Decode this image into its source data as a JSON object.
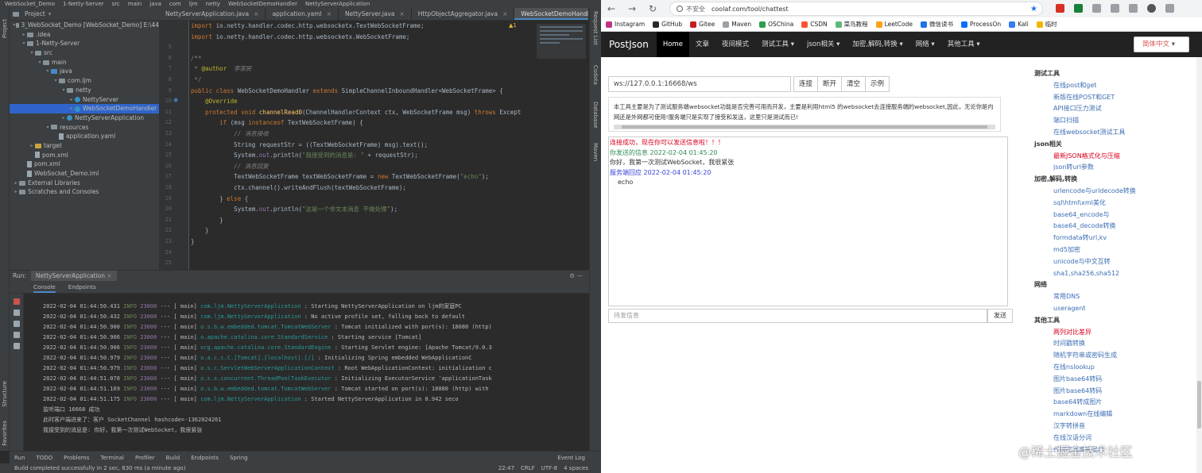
{
  "ide": {
    "top_crumbs": [
      "WebSocket_Demo",
      "1-Netty-Server",
      "src",
      "main",
      "java",
      "com",
      "ljm",
      "netty",
      "WebSocketDemoHandler",
      "NettyServerApplication"
    ],
    "tabs": [
      {
        "label": "NettyServerApplication.java"
      },
      {
        "label": "application.yaml"
      },
      {
        "label": "NettyServer.java"
      },
      {
        "label": "HttpObjectAggregator.java"
      },
      {
        "label": "WebSocketDemoHandler.java",
        "active": true
      }
    ],
    "project_header": "Project",
    "tree": [
      {
        "label": "3_WebSocket_Demo [WebSocket_Demo]  E:\\44",
        "indent": 0,
        "arrow": "▾",
        "icon": "folder"
      },
      {
        "label": ".idea",
        "indent": 1,
        "arrow": "▸",
        "icon": "folder"
      },
      {
        "label": "1-Netty-Server",
        "indent": 1,
        "arrow": "▾",
        "icon": "folder"
      },
      {
        "label": "src",
        "indent": 2,
        "arrow": "▾",
        "icon": "folder"
      },
      {
        "label": "main",
        "indent": 3,
        "arrow": "▾",
        "icon": "folder"
      },
      {
        "label": "java",
        "indent": 4,
        "arrow": "▾",
        "icon": "folder-blue"
      },
      {
        "label": "com.ljm",
        "indent": 5,
        "arrow": "▾",
        "icon": "folder"
      },
      {
        "label": "netty",
        "indent": 6,
        "arrow": "▾",
        "icon": "folder"
      },
      {
        "label": "NettyServer",
        "indent": 7,
        "arrow": "▸",
        "icon": "class"
      },
      {
        "label": "WebSocketDemoHandler",
        "indent": 7,
        "arrow": "▸",
        "icon": "class",
        "selected": true
      },
      {
        "label": "NettyServerApplication",
        "indent": 6,
        "arrow": "▸",
        "icon": "class"
      },
      {
        "label": "resources",
        "indent": 4,
        "arrow": "▾",
        "icon": "folder"
      },
      {
        "label": "application.yaml",
        "indent": 5,
        "arrow": "",
        "icon": "file"
      },
      {
        "label": "target",
        "indent": 2,
        "arrow": "▸",
        "icon": "folder-org"
      },
      {
        "label": "pom.xml",
        "indent": 2,
        "arrow": "",
        "icon": "file"
      },
      {
        "label": "pom.xml",
        "indent": 1,
        "arrow": "",
        "icon": "file"
      },
      {
        "label": "WebSocket_Demo.iml",
        "indent": 1,
        "arrow": "",
        "icon": "file"
      },
      {
        "label": "External Libraries",
        "indent": 0,
        "arrow": "▸",
        "icon": "folder"
      },
      {
        "label": "Scratches and Consoles",
        "indent": 0,
        "arrow": "▸",
        "icon": "folder"
      }
    ],
    "code_lines": [
      {
        "n": "",
        "html": "<span class='kw'>import</span> io.netty.handler.codec.http.websocketx.<span>TextWebSocketFrame</span>;"
      },
      {
        "n": "",
        "html": "<span class='kw'>import</span> io.netty.handler.codec.http.websocketx.WebSocketFrame;"
      },
      {
        "n": "5",
        "html": ""
      },
      {
        "n": "6",
        "html": "<span class='cm'>/**</span>"
      },
      {
        "n": "7",
        "html": "<span class='cm'> * </span><span class='an'>@author</span><span class='cm'>  李家民</span>"
      },
      {
        "n": "8",
        "html": "<span class='cm'> */</span>"
      },
      {
        "n": "9",
        "html": "<span class='kw'>public class</span> WebSocketDemoHandler <span class='kw'>extends</span> SimpleChannelInboundHandler&lt;WebSocketFrame&gt; {"
      },
      {
        "n": "10",
        "html": "    <span class='an'>@Override</span>"
      },
      {
        "n": "11",
        "html": "    <span class='kw'>protected void</span> <span class='fn'>channelRead0</span>(ChannelHandlerContext ctx, WebSocketFrame msg) <span class='kw'>throws</span> Except"
      },
      {
        "n": "12",
        "html": "        <span class='kw'>if</span> (msg <span class='kw'>instanceof</span> TextWebSocketFrame) {"
      },
      {
        "n": "13",
        "html": "            <span class='cm'>// 消息接收</span>"
      },
      {
        "n": "14",
        "html": "            String requestStr = ((TextWebSocketFrame) msg).text();"
      },
      {
        "n": "15",
        "html": "            System.<span class='fi'>out</span>.println(<span class='st'>\"我接受到的消息是: \"</span> + requestStr);"
      },
      {
        "n": "16",
        "html": "            <span class='cm'>// 消息回复</span>"
      },
      {
        "n": "17",
        "html": "            TextWebSocketFrame textWebSocketFrame = <span class='kw'>new</span> TextWebSocketFrame(<span class='st'>\"echo\"</span>);"
      },
      {
        "n": "18",
        "html": "            ctx.channel().writeAndFlush(textWebSocketFrame);"
      },
      {
        "n": "19",
        "html": "        } <span class='kw'>else</span> {"
      },
      {
        "n": "20",
        "html": "            System.<span class='fi'>out</span>.println(<span class='st'>\"这是一个非文本消息 不做处理\"</span>);"
      },
      {
        "n": "21",
        "html": "        }"
      },
      {
        "n": "22",
        "html": "    }"
      },
      {
        "n": "23",
        "html": "}"
      },
      {
        "n": "24",
        "html": ""
      },
      {
        "n": "25",
        "html": ""
      },
      {
        "n": "26",
        "html": ""
      }
    ],
    "warn_count": "▲1",
    "run_label": "Run:",
    "run_tab": "NettyServerApplication",
    "run_subtabs": [
      "Console",
      "Endpoints"
    ],
    "console_lines": [
      {
        "ts": "2022-02-04 01:44:50.431",
        "lv": "INFO",
        "pid": "23000",
        "th": "---  [           main]",
        "lg": "com.ljm.NettyServerApplication          ",
        "msg": ": Starting NettyServerApplication on ljm的家庭PC"
      },
      {
        "ts": "2022-02-04 01:44:50.432",
        "lv": "INFO",
        "pid": "23000",
        "th": "---  [           main]",
        "lg": "com.ljm.NettyServerApplication          ",
        "msg": ": No active profile set, falling back to default"
      },
      {
        "ts": "2022-02-04 01:44:50.900",
        "lv": "INFO",
        "pid": "23000",
        "th": "---  [           main]",
        "lg": "o.s.b.w.embedded.tomcat.TomcatWebServer ",
        "msg": ": Tomcat initialized with port(s): 18080 (http)"
      },
      {
        "ts": "2022-02-04 01:44:50.906",
        "lv": "INFO",
        "pid": "23000",
        "th": "---  [           main]",
        "lg": "o.apache.catalina.core.StandardService  ",
        "msg": ": Starting service [Tomcat]"
      },
      {
        "ts": "2022-02-04 01:44:50.906",
        "lv": "INFO",
        "pid": "23000",
        "th": "---  [           main]",
        "lg": "org.apache.catalina.core.StandardEngine ",
        "msg": ": Starting Servlet engine: [Apache Tomcat/9.0.3"
      },
      {
        "ts": "2022-02-04 01:44:50.979",
        "lv": "INFO",
        "pid": "23000",
        "th": "---  [           main]",
        "lg": "o.a.c.c.C.[Tomcat].[localhost].[/]     ",
        "msg": ": Initializing Spring embedded WebApplicationC"
      },
      {
        "ts": "2022-02-04 01:44:50.979",
        "lv": "INFO",
        "pid": "23000",
        "th": "---  [           main]",
        "lg": "o.s.c.ServletWebServerApplicationContext",
        "msg": ": Root WebApplicationContext: initialization c"
      },
      {
        "ts": "2022-02-04 01:44:51.078",
        "lv": "INFO",
        "pid": "23000",
        "th": "---  [           main]",
        "lg": "o.s.s.concurrent.ThreadPoolTaskExecutor ",
        "msg": ": Initializing ExecutorService 'applicationTask"
      },
      {
        "ts": "2022-02-04 01:44:51.169",
        "lv": "INFO",
        "pid": "23000",
        "th": "---  [           main]",
        "lg": "o.s.b.w.embedded.tomcat.TomcatWebServer ",
        "msg": ": Tomcat started on port(s): 18080 (http) with"
      },
      {
        "ts": "2022-02-04 01:44:51.175",
        "lv": "INFO",
        "pid": "23000",
        "th": "---  [           main]",
        "lg": "com.ljm.NettyServerApplication          ",
        "msg": ": Started NettyServerApplication in 0.942 seco"
      }
    ],
    "console_plain": [
      "监听端口 16668 成功",
      "此时客户端进来了：客户 SocketChannel hashcode=-1362024261",
      "我接受到的消息是: 你好，我第一次测试WebSocket，我很紧张"
    ],
    "bottom_tabs": [
      "Run",
      "TODO",
      "Problems",
      "Terminal",
      "Profiler",
      "Build",
      "Endpoints",
      "Spring"
    ],
    "event_log": "Event Log",
    "status_text": "Build completed successfully in 2 sec, 830 ms (a minute ago)",
    "status_right": [
      "22:47",
      "CRLF",
      "UTF-8",
      "4 spaces"
    ],
    "left_labels": [
      "Project",
      "Structure",
      "Favorites"
    ],
    "right_labels": [
      "Request List",
      "Codota",
      "Database",
      "Maven"
    ]
  },
  "browser": {
    "not_secure": "不安全",
    "url": "coolaf.com/tool/chattest",
    "bookmarks": [
      {
        "label": "Instagram",
        "color": "#c13584"
      },
      {
        "label": "GitHub",
        "color": "#24292e"
      },
      {
        "label": "Gitee",
        "color": "#c71d23"
      },
      {
        "label": "Maven",
        "color": "#9aa0a6"
      },
      {
        "label": "OSChina",
        "color": "#2e9e4f"
      },
      {
        "label": "CSDN",
        "color": "#fc5531"
      },
      {
        "label": "菜鸟教程",
        "color": "#5fb878"
      },
      {
        "label": "LeetCode",
        "color": "#ffa116"
      },
      {
        "label": "微信读书",
        "color": "#1a73e8"
      },
      {
        "label": "ProcessOn",
        "color": "#0d6efd"
      },
      {
        "label": "Kali",
        "color": "#367bf0"
      },
      {
        "label": "临时",
        "color": "#f2b600"
      }
    ],
    "nav": {
      "brand": "PostJson",
      "items": [
        {
          "label": "Home",
          "active": true
        },
        {
          "label": "文章"
        },
        {
          "label": "夜间模式"
        },
        {
          "label": "测试工具 ▾"
        },
        {
          "label": "json相关 ▾"
        },
        {
          "label": "加密,解码,转换 ▾"
        },
        {
          "label": "网络 ▾"
        },
        {
          "label": "其他工具 ▾"
        }
      ],
      "lang": "简体中文"
    },
    "ws_url": "ws://127.0.0.1:16668/ws",
    "buttons": [
      "连接",
      "断开",
      "清空",
      "示例"
    ],
    "description": "本工具主要是为了测试服务端websocket功能是否完善可用而开发，主要是利用html5 的websocket去连接服务端的websocket,因此，无论你是内网还是外网都可使用!服务端只是实现了接受和发送，这里只是测试而已!",
    "messages": [
      {
        "text": "连接成功，现在你可以发送信息啦！！！",
        "cls": "m-red"
      },
      {
        "text": "你发送的信息 2022-02-04 01:45:20",
        "cls": "m-green"
      },
      {
        "text": "你好，我第一次测试WebSocket，我很紧张",
        "cls": "m-dark"
      },
      {
        "text": "服务端回应 2022-02-04 01:45:20",
        "cls": "m-blue"
      },
      {
        "text": "echo",
        "cls": "m-ind"
      }
    ],
    "send_placeholder": "待发信息",
    "send_button": "发送",
    "sidebar": [
      {
        "h": "测试工具",
        "items": [
          {
            "t": "在线post和get"
          },
          {
            "t": "新版在线POST和GET"
          },
          {
            "t": "API接口压力测试"
          },
          {
            "t": "端口扫描"
          },
          {
            "t": "在线websocket测试工具"
          }
        ]
      },
      {
        "h": "json相关",
        "items": [
          {
            "t": "最新JSON格式化与压缩",
            "red": true
          },
          {
            "t": "json转url参数"
          }
        ]
      },
      {
        "h": "加密,解码,转换",
        "items": [
          {
            "t": "urlencode与urldecode转换"
          },
          {
            "t": "sql\\html\\xml美化"
          },
          {
            "t": "base64_encode与"
          },
          {
            "t": "base64_decode转换"
          },
          {
            "t": "formdata转url,kv"
          },
          {
            "t": "md5加密"
          },
          {
            "t": "unicode与中文互转"
          },
          {
            "t": "sha1,sha256,sha512"
          }
        ]
      },
      {
        "h": "网络",
        "items": [
          {
            "t": "常用DNS"
          },
          {
            "t": "useragent"
          }
        ]
      },
      {
        "h": "其他工具",
        "items": [
          {
            "t": "两列对比差异",
            "red": true
          },
          {
            "t": "时间戳转换"
          },
          {
            "t": "随机字符串或密码生成"
          },
          {
            "t": "在线nslookup"
          },
          {
            "t": "图片base64转码"
          },
          {
            "t": "图片base64转码"
          },
          {
            "t": "base64转成图片"
          },
          {
            "t": "markdown在线编辑"
          },
          {
            "t": "汉字转拼音"
          },
          {
            "t": "在线汉语分词"
          },
          {
            "t": "代码在线高亮显示"
          }
        ]
      }
    ],
    "watermark": "@稀土掘金技术社区"
  }
}
